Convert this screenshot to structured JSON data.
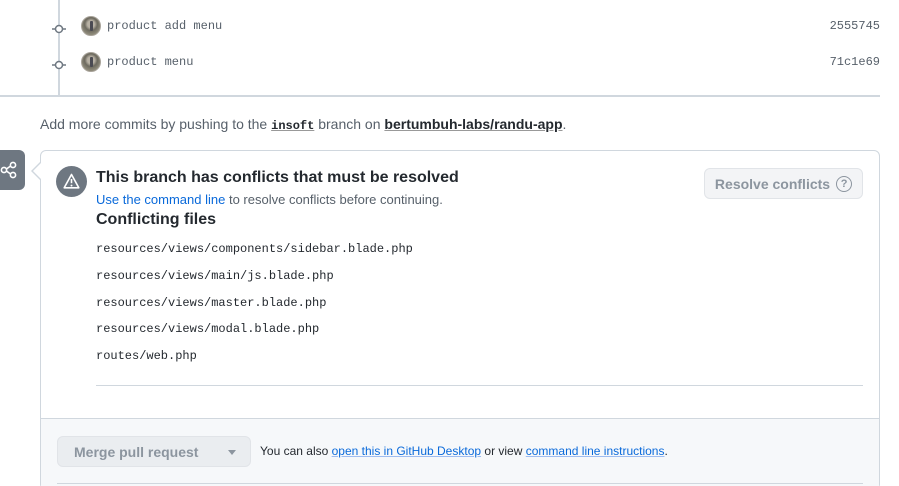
{
  "commits": [
    {
      "message": "product add menu",
      "sha": "2555745"
    },
    {
      "message": "product menu",
      "sha": "71c1e69"
    }
  ],
  "push_note": {
    "prefix": "Add more commits by pushing to the",
    "branch": "insoft",
    "middle": "branch on",
    "repo": "bertumbuh-labs/randu-app",
    "suffix": "."
  },
  "conflicts": {
    "title": "This branch has conflicts that must be resolved",
    "sub_link": "Use the command line",
    "sub_rest": "to resolve conflicts before continuing.",
    "files_heading": "Conflicting files",
    "files": [
      "resources/views/components/sidebar.blade.php",
      "resources/views/main/js.blade.php",
      "resources/views/master.blade.php",
      "resources/views/modal.blade.php",
      "routes/web.php"
    ],
    "resolve_label": "Resolve conflicts",
    "help_glyph": "?"
  },
  "merge": {
    "button_label": "Merge pull request",
    "note_prefix": "You can also",
    "desktop_link": "open this in GitHub Desktop",
    "note_middle": "or view",
    "cli_link": "command line instructions",
    "note_suffix": "."
  },
  "icons": {
    "commit": "git-commit-icon",
    "merge": "git-merge-icon",
    "warning": "alert-triangle-icon",
    "caret": "caret-down-icon"
  },
  "colors": {
    "link": "#0969da",
    "muted": "#57606a",
    "icon_gray": "#6e7781",
    "border": "#d0d7de",
    "footer_bg": "#f6f8fa"
  }
}
